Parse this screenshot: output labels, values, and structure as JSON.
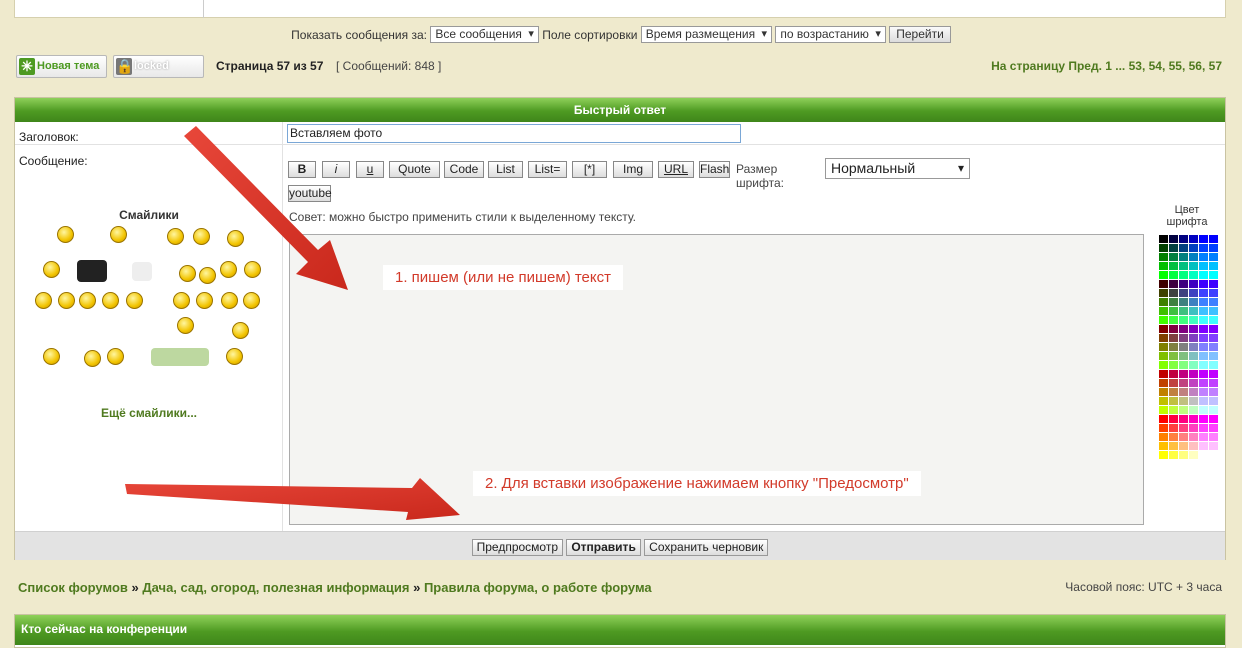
{
  "sort": {
    "show_label": "Показать сообщения за:",
    "show_value": "Все сообщения",
    "sort_label": "Поле сортировки",
    "sort_value": "Время размещения",
    "order_value": "по возрастанию",
    "go_button": "Перейти"
  },
  "pagination": {
    "new_topic": "Новая тема",
    "locked": "locked",
    "page_text": "Страница 57 из 57",
    "posts_count": "[ Сообщений: 848 ]",
    "nav": "На страницу Пред.  1 ... 53, 54, 55, 56, 57"
  },
  "quick_reply": {
    "header": "Быстрый ответ",
    "subject_label": "Заголовок:",
    "subject_value": "Вставляем фото",
    "message_label": "Сообщение:",
    "smilies_title": "Смайлики",
    "more_smilies": "Ещё смайлики...",
    "toolbar": [
      "B",
      "i",
      "u",
      "Quote",
      "Code",
      "List",
      "List=",
      "[*]",
      "Img",
      "URL",
      "Flash"
    ],
    "youtube": "youtube",
    "font_size_label": "Размер шрифта:",
    "font_size_value": "Нормальный",
    "hint": "Совет: можно быстро применить стили к выделенному тексту.",
    "color_label_line1": "Цвет",
    "color_label_line2": "шрифта",
    "annotation1": "1. пишем (или не пишем) текст",
    "annotation2": "2. Для вставки изображение нажимаем кнопку \"Предосмотр\"",
    "preview_button": "Предпросмотр",
    "submit_button": "Отправить",
    "draft_button": "Сохранить черновик"
  },
  "breadcrumbs": {
    "item1": "Список форумов",
    "item2": "Дача, сад, огород, полезная информация",
    "item3": "Правила форума, о работе форума",
    "separator": "»"
  },
  "timezone": "Часовой пояс: UTC + 3 часа",
  "who_online": "Кто сейчас на конференции",
  "colors": {
    "accent_green": "#4e9a22",
    "link_green": "#4f7a1f",
    "annotation_red": "#d23a2a",
    "page_bg": "#efeacd"
  }
}
